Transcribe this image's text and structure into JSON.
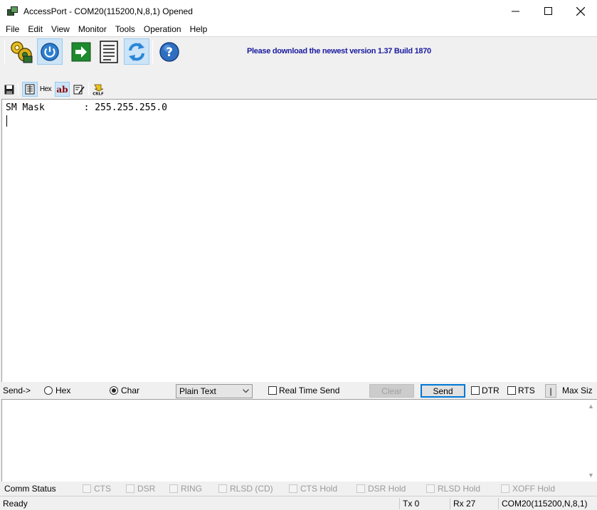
{
  "window": {
    "title": "AccessPort - COM20(115200,N,8,1) Opened"
  },
  "menu": [
    "File",
    "Edit",
    "View",
    "Monitor",
    "Tools",
    "Operation",
    "Help"
  ],
  "toolbar": {
    "notice": "Please download the newest version 1.37 Build 1870",
    "buttons": [
      "settings-icon",
      "power-icon",
      "go-arrow-icon",
      "notepad-icon",
      "refresh-icon",
      "help-icon"
    ]
  },
  "toolbar2": {
    "hex_label": "Hex",
    "ab_label": "ab"
  },
  "receive": {
    "line1": "SM Mask       : 255.255.255.0"
  },
  "send": {
    "label": "Send->",
    "hex_label": "Hex",
    "char_label": "Char",
    "format_value": "Plain Text",
    "realtime_label": "Real Time Send",
    "clear_label": "Clear",
    "send_label": "Send",
    "dtr_label": "DTR",
    "rts_label": "RTS",
    "pipe_label": "|",
    "maxsize_label": "Max Siz",
    "mode": "Char"
  },
  "comm": {
    "label": "Comm Status",
    "items": [
      "CTS",
      "DSR",
      "RING",
      "RLSD (CD)",
      "CTS Hold",
      "DSR Hold",
      "RLSD Hold",
      "XOFF Hold"
    ]
  },
  "status": {
    "ready": "Ready",
    "tx": "Tx 0",
    "rx": "Rx 27",
    "port": "COM20(115200,N,8,1)"
  },
  "colors": {
    "accent": "#0078d7",
    "notice": "#1a1aa0",
    "active_toolbar": "#cce4f7"
  }
}
